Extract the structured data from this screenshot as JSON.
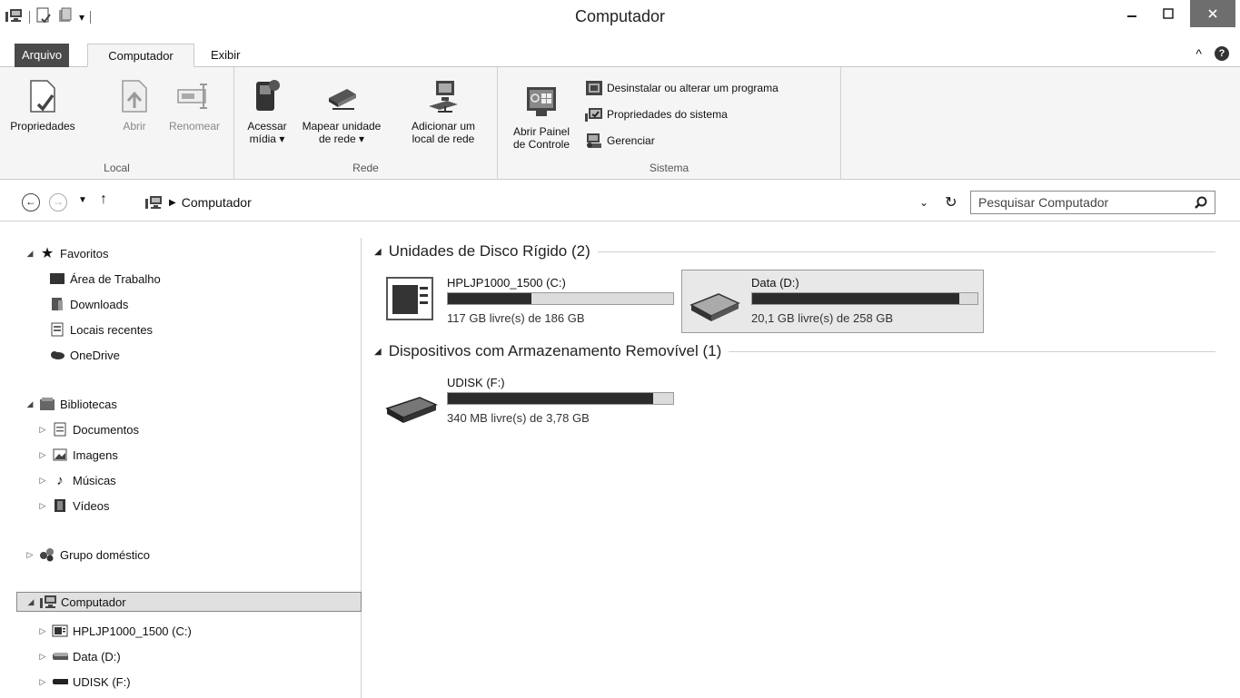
{
  "window": {
    "title": "Computador"
  },
  "tabs": {
    "file": "Arquivo",
    "computer": "Computador",
    "view": "Exibir"
  },
  "ribbon": {
    "local": {
      "label": "Local",
      "properties": "Propriedades",
      "open": "Abrir",
      "rename": "Renomear"
    },
    "network": {
      "label": "Rede",
      "access_media_1": "Acessar",
      "access_media_2": "mídia ▾",
      "map_drive_1": "Mapear unidade",
      "map_drive_2": "de rede ▾",
      "add_location_1": "Adicionar um",
      "add_location_2": "local de rede"
    },
    "system": {
      "label": "Sistema",
      "control_panel_1": "Abrir Painel",
      "control_panel_2": "de Controle",
      "uninstall": "Desinstalar ou alterar um programa",
      "sys_props": "Propriedades do sistema",
      "manage": "Gerenciar"
    }
  },
  "address": {
    "path": "Computador",
    "search_placeholder": "Pesquisar Computador"
  },
  "nav": {
    "favorites": "Favoritos",
    "desktop": "Área de Trabalho",
    "downloads": "Downloads",
    "recent": "Locais recentes",
    "onedrive": "OneDrive",
    "libraries": "Bibliotecas",
    "documents": "Documentos",
    "images": "Imagens",
    "music": "Músicas",
    "videos": "Vídeos",
    "homegroup": "Grupo doméstico",
    "computer": "Computador",
    "drive_c": "HPLJP1000_1500 (C:)",
    "drive_d": "Data (D:)",
    "drive_f": "UDISK (F:)"
  },
  "content": {
    "hdd_section": "Unidades de Disco Rígido (2)",
    "removable_section": "Dispositivos com Armazenamento Removível (1)",
    "drives": [
      {
        "name": "HPLJP1000_1500 (C:)",
        "info": "117 GB livre(s) de 186 GB",
        "used_fraction": 0.37
      },
      {
        "name": "Data (D:)",
        "info": "20,1 GB livre(s) de 258 GB",
        "used_fraction": 0.92
      },
      {
        "name": "UDISK (F:)",
        "info": "340 MB livre(s) de 3,78 GB",
        "used_fraction": 0.91
      }
    ]
  }
}
